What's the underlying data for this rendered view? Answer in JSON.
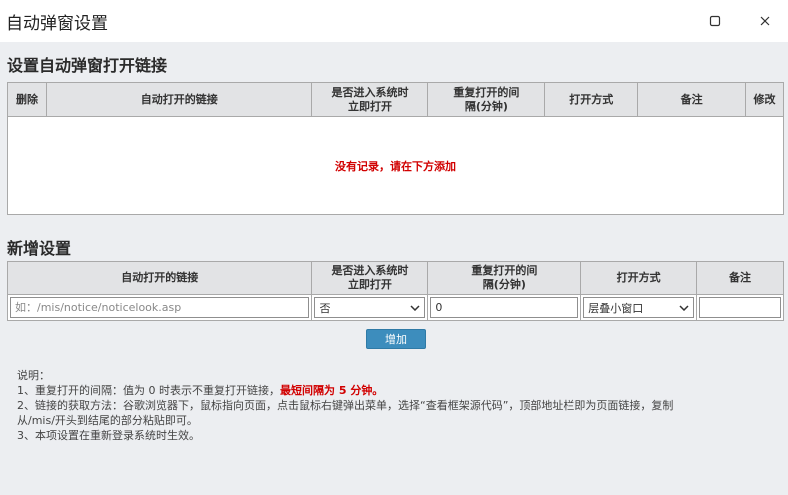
{
  "window": {
    "title": "自动弹窗设置"
  },
  "section1": {
    "title": "设置自动弹窗打开链接",
    "headers": [
      "删除",
      "自动打开的链接",
      "是否进入系统时立即打开",
      "重复打开的间隔(分钟)",
      "打开方式",
      "备注",
      "修改"
    ],
    "empty_message": "没有记录，请在下方添加"
  },
  "section2": {
    "title": "新增设置",
    "headers": [
      "自动打开的链接",
      "是否进入系统时立即打开",
      "重复打开的间隔(分钟)",
      "打开方式",
      "备注"
    ],
    "link_placeholder": "如：/mis/notice/noticelook.asp",
    "immediate_value": "否",
    "interval_value": "0",
    "open_mode_value": "层叠小窗口",
    "remark_value": "",
    "add_label": "增加"
  },
  "notes": {
    "heading": "说明：",
    "line1_prefix": "1、重复打开的间隔：值为 0 时表示不重复打开链接，",
    "line1_highlight": "最短间隔为 5 分钟。",
    "line2a": "2、链接的获取方法：谷歌浏览器下，鼠标指向页面，点击鼠标右键弹出菜单，选择“查看框架源代码”，顶部地址栏即为页面链接，复制",
    "line2b": "从/mis/开头到结尾的部分粘贴即可。",
    "line3": "3、本项设置在重新登录系统时生效。"
  },
  "colors": {
    "accent": "#3d8dbd",
    "warning": "#d10000",
    "background": "#eceef1",
    "header_bg": "#e2e3e5"
  }
}
